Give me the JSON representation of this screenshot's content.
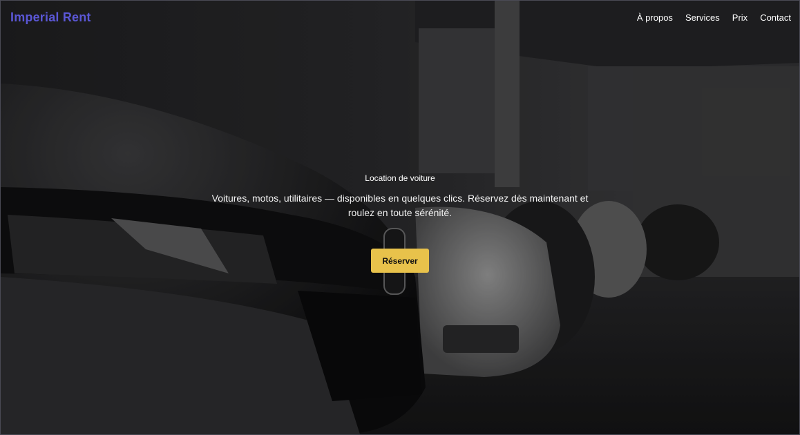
{
  "brand": {
    "name": "Imperial Rent",
    "color": "#5b57d6"
  },
  "nav": {
    "links": [
      {
        "label": "À propos"
      },
      {
        "label": "Services"
      },
      {
        "label": "Prix"
      },
      {
        "label": "Contact"
      }
    ]
  },
  "hero": {
    "eyebrow": "Location de voiture",
    "tagline": "Voitures, motos, utilitaires — disponibles en quelques clics. Réservez dès maintenant et roulez en toute sérénité.",
    "cta_label": "Réserver",
    "cta_color": "#e8c24b",
    "background": "grayscale-photo-of-parked-cars"
  }
}
